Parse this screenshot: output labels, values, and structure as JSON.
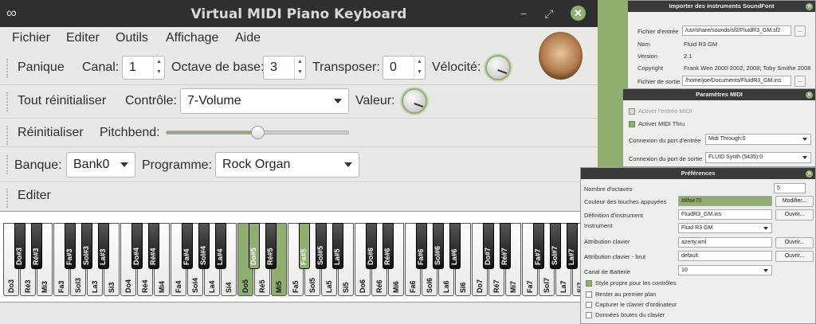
{
  "window": {
    "title": "Virtual MIDI Piano Keyboard"
  },
  "menu": [
    "Fichier",
    "Editer",
    "Outils",
    "Affichage",
    "Aide"
  ],
  "row1": {
    "panic": "Panique",
    "channel_label": "Canal:",
    "channel_value": "1",
    "octave_label": "Octave de base:",
    "octave_value": "3",
    "transpose_label": "Transposer:",
    "transpose_value": "0",
    "velocity_label": "Vélocité:"
  },
  "row2": {
    "reset_all": "Tout réinitialiser",
    "control_label": "Contrôle:",
    "control_value": "7-Volume",
    "value_label": "Valeur:"
  },
  "row3": {
    "reset": "Réinitialiser",
    "pitchbend_label": "Pitchbend:",
    "pitchbend_value": 0.5
  },
  "row4": {
    "bank_label": "Banque:",
    "bank_value": "Bank0",
    "program_label": "Programme:",
    "program_value": "Rock Organ"
  },
  "row5": {
    "edit": "Editer"
  },
  "keyboard": {
    "white": [
      "Do3",
      "Ré3",
      "Mi3",
      "Fa3",
      "Sol3",
      "La3",
      "Si3",
      "Do4",
      "Ré4",
      "Mi4",
      "Fa4",
      "Sol4",
      "La4",
      "Si4",
      "Do5",
      "Ré5",
      "Mi5",
      "Fa5",
      "Sol5",
      "La5",
      "Si5",
      "Do6",
      "Ré6",
      "Mi6",
      "Fa6",
      "Sol6",
      "La6",
      "Si6",
      "Do7",
      "Ré7",
      "Mi7",
      "Fa7",
      "Sol7",
      "La7",
      "Si7"
    ],
    "white_pressed": [
      14,
      16
    ],
    "black": [
      "Do#3",
      "Ré#3",
      "Fa#3",
      "Sol#3",
      "La#3",
      "Do#4",
      "Ré#4",
      "Fa#4",
      "Sol#4",
      "La#4",
      "Do#5",
      "Ré#5",
      "Fa#5",
      "Sol#5",
      "La#5",
      "Do#6",
      "Ré#6",
      "Fa#6",
      "Sol#6",
      "La#6",
      "Do#7",
      "Ré#7",
      "Fa#7",
      "Sol#7",
      "La#7"
    ],
    "black_pressed": [
      10,
      12
    ]
  },
  "soundfont": {
    "title": "Importer des instruments SoundFont",
    "input_label": "Fichier d'entrée",
    "input_value": "/usr/share/sounds/sf2/FluidR3_GM.sf2",
    "browse": "...",
    "name_label": "Nom",
    "name_value": "Fluid R3 GM",
    "version_label": "Version",
    "version_value": "2.1",
    "copyright_label": "Copyright",
    "copyright_value": "Frank Wen 2000-2002, 2008; Toby Smithe 2008",
    "output_label": "Fichier de sortie",
    "output_value": "/home/joe/Documents/FluidR3_GM.ins"
  },
  "midi": {
    "title": "Paramètres MIDI",
    "enable_in": "Activer l'entrée MIDI",
    "enable_thru": "Activer MIDI Thru",
    "in_port_label": "Connexion du port d'entrée",
    "in_port_value": "Midi Through:0",
    "out_port_label": "Connexion du port de sortie",
    "out_port_value": "FLUID Synth (5435):0"
  },
  "prefs": {
    "title": "Préférences",
    "octaves_label": "Nombre d'octaves",
    "octaves_value": "5",
    "color_label": "Couleur des touches appuyées",
    "color_value": "#8fae70",
    "modify": "Modifier...",
    "instr_def_label": "Définition d'instrument",
    "instr_def_value": "FluidR3_GM.ins",
    "open": "Ouvrir...",
    "instrument_label": "Instrument",
    "instrument_value": "Fluid R3 GM",
    "keymap_label": "Attribution clavier",
    "keymap_value": "azerty.xml",
    "rawkeymap_label": "Attribution clavier - brut",
    "rawkeymap_value": "default",
    "drum_label": "Canal de Batterie",
    "drum_value": "10",
    "opt1": "Style propre pour les contrôles",
    "opt2": "Rester au premier plan",
    "opt3": "Capturer le clavier d'ordinateur",
    "opt4": "Données brutes du clavier"
  },
  "colors": {
    "accent": "#8fae70",
    "titlebar": "#2f2f2f"
  }
}
